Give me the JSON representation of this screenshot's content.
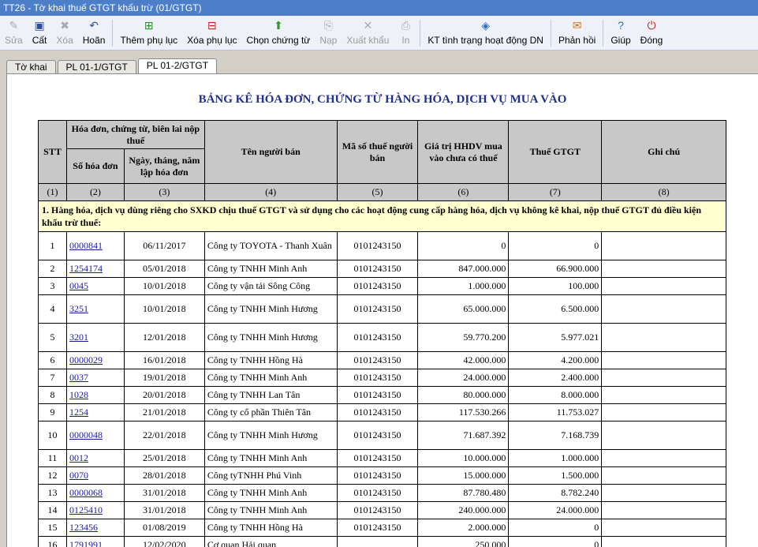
{
  "window": {
    "title": "TT26 - Tờ khai thuế GTGT khấu trừ (01/GTGT)"
  },
  "toolbar": [
    {
      "label": "Sửa",
      "icon": "edit-icon",
      "enabled": false
    },
    {
      "label": "Cất",
      "icon": "save-icon",
      "enabled": true
    },
    {
      "label": "Xóa",
      "icon": "delete-icon",
      "enabled": false
    },
    {
      "label": "Hoãn",
      "icon": "undo-icon",
      "enabled": true
    },
    {
      "label": "Thêm phụ lục",
      "icon": "add-appendix-icon",
      "enabled": true
    },
    {
      "label": "Xóa phụ lục",
      "icon": "remove-appendix-icon",
      "enabled": true
    },
    {
      "label": "Chọn chứng từ",
      "icon": "select-document-icon",
      "enabled": true
    },
    {
      "label": "Nạp",
      "icon": "load-icon",
      "enabled": false
    },
    {
      "label": "Xuất khẩu",
      "icon": "export-icon",
      "enabled": false
    },
    {
      "label": "In",
      "icon": "print-icon",
      "enabled": false
    },
    {
      "label": "KT tình trạng hoạt động DN",
      "icon": "check-status-icon",
      "enabled": true
    },
    {
      "label": "Phản hồi",
      "icon": "mail-icon",
      "enabled": true
    },
    {
      "label": "Giúp",
      "icon": "help-icon",
      "enabled": true
    },
    {
      "label": "Đóng",
      "icon": "close-icon",
      "enabled": true
    }
  ],
  "tabs": [
    {
      "label": "Tờ khai",
      "active": false
    },
    {
      "label": "PL 01-1/GTGT",
      "active": false
    },
    {
      "label": "PL 01-2/GTGT",
      "active": true
    }
  ],
  "document": {
    "title": "BẢNG KÊ HÓA ĐƠN, CHỨNG TỪ HÀNG HÓA, DỊCH VỤ MUA VÀO",
    "headers": {
      "stt": "STT",
      "invoice_group": "Hóa đơn, chứng từ, biên lai nộp thuế",
      "invoice_no": "Số hóa đơn",
      "date": "Ngày, tháng, năm lập hóa đơn",
      "seller": "Tên người bán",
      "tax_id": "Mã số thuế người bán",
      "value": "Giá trị HHDV mua vào chưa có thuế",
      "vat": "Thuế GTGT",
      "note": "Ghi chú"
    },
    "column_numbers": [
      "(1)",
      "(2)",
      "(3)",
      "(4)",
      "(5)",
      "(6)",
      "(7)",
      "(8)"
    ],
    "section_title": "1. Hàng hóa, dịch vụ dùng riêng cho SXKD chịu thuế GTGT và sử dụng cho các hoạt động cung cấp hàng hóa, dịch vụ không kê khai, nộp thuế GTGT đủ điều kiện khấu trừ thuế:",
    "rows": [
      {
        "stt": "1",
        "no": "0000841",
        "date": "06/11/2017",
        "seller": "Công ty TOYOTA - Thanh Xuân",
        "mst": "0101243150",
        "value": "0",
        "vat": "0",
        "tall": true
      },
      {
        "stt": "2",
        "no": "1254174",
        "date": "05/01/2018",
        "seller": "Công ty TNHH Minh Anh",
        "mst": "0101243150",
        "value": "847.000.000",
        "vat": "66.900.000"
      },
      {
        "stt": "3",
        "no": "0045",
        "date": "10/01/2018",
        "seller": "Công ty vận tải Sông Công",
        "mst": "0101243150",
        "value": "1.000.000",
        "vat": "100.000"
      },
      {
        "stt": "4",
        "no": "3251",
        "date": "10/01/2018",
        "seller": "Công ty TNHH Minh Hương",
        "mst": "0101243150",
        "value": "65.000.000",
        "vat": "6.500.000",
        "tall": true
      },
      {
        "stt": "5",
        "no": "3201",
        "date": "12/01/2018",
        "seller": "Công ty TNHH Minh Hương",
        "mst": "0101243150",
        "value": "59.770.200",
        "vat": "5.977.021",
        "tall": true
      },
      {
        "stt": "6",
        "no": "0000029",
        "date": "16/01/2018",
        "seller": "Công ty TNHH Hồng Hà",
        "mst": "0101243150",
        "value": "42.000.000",
        "vat": "4.200.000"
      },
      {
        "stt": "7",
        "no": "0037",
        "date": "19/01/2018",
        "seller": "Công ty TNHH Minh Anh",
        "mst": "0101243150",
        "value": "24.000.000",
        "vat": "2.400.000"
      },
      {
        "stt": "8",
        "no": "1028",
        "date": "20/01/2018",
        "seller": "Công ty TNHH Lan Tân",
        "mst": "0101243150",
        "value": "80.000.000",
        "vat": "8.000.000"
      },
      {
        "stt": "9",
        "no": "1254",
        "date": "21/01/2018",
        "seller": "Công ty cổ phần Thiên Tân",
        "mst": "0101243150",
        "value": "117.530.266",
        "vat": "11.753.027"
      },
      {
        "stt": "10",
        "no": "0000048",
        "date": "22/01/2018",
        "seller": "Công ty TNHH Minh Hương",
        "mst": "0101243150",
        "value": "71.687.392",
        "vat": "7.168.739",
        "tall": true
      },
      {
        "stt": "11",
        "no": "0012",
        "date": "25/01/2018",
        "seller": "Công ty TNHH Minh Anh",
        "mst": "0101243150",
        "value": "10.000.000",
        "vat": "1.000.000"
      },
      {
        "stt": "12",
        "no": "0070",
        "date": "28/01/2018",
        "seller": "Công tyTNHH Phú Vinh",
        "mst": "0101243150",
        "value": "15.000.000",
        "vat": "1.500.000"
      },
      {
        "stt": "13",
        "no": "0000068",
        "date": "31/01/2018",
        "seller": "Công ty TNHH Minh Anh",
        "mst": "0101243150",
        "value": "87.780.480",
        "vat": "8.782.240"
      },
      {
        "stt": "14",
        "no": "0125410",
        "date": "31/01/2018",
        "seller": "Công ty TNHH Minh Anh",
        "mst": "0101243150",
        "value": "240.000.000",
        "vat": "24.000.000"
      },
      {
        "stt": "15",
        "no": "123456",
        "date": "01/08/2019",
        "seller": "Công ty TNHH Hồng Hà",
        "mst": "0101243150",
        "value": "2.000.000",
        "vat": "0"
      },
      {
        "stt": "16",
        "no": "1791991",
        "date": "12/02/2020",
        "seller": "Cơ quan Hải quan",
        "mst": "",
        "value": "250.000",
        "vat": "0"
      }
    ]
  },
  "colors": {
    "titlebar": "#4d7fc9",
    "header_bg": "#c8c8c8",
    "section_bg": "#ffffd0",
    "title_text": "#1f2f8c",
    "link": "#1a1aa0"
  }
}
